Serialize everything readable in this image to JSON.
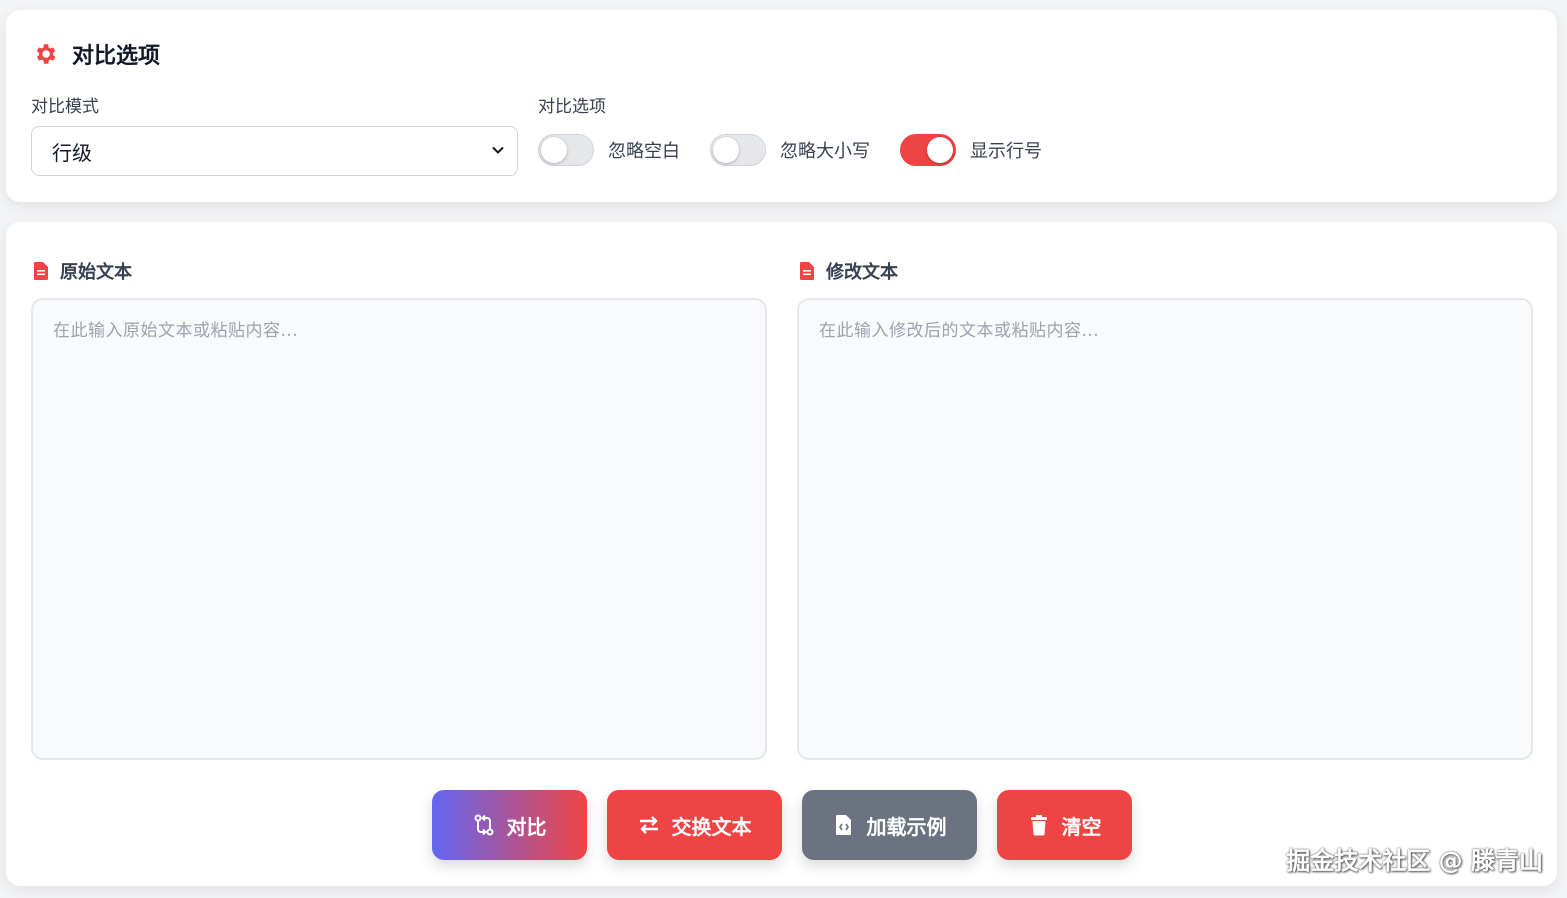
{
  "options": {
    "title": "对比选项",
    "mode_label": "对比模式",
    "mode_value": "行级",
    "options_label": "对比选项",
    "toggles": [
      {
        "label": "忽略空白",
        "on": false
      },
      {
        "label": "忽略大小写",
        "on": false
      },
      {
        "label": "显示行号",
        "on": true
      }
    ]
  },
  "editor": {
    "left_title": "原始文本",
    "left_placeholder": "在此输入原始文本或粘贴内容...",
    "right_title": "修改文本",
    "right_placeholder": "在此输入修改后的文本或粘贴内容..."
  },
  "actions": {
    "compare": "对比",
    "swap": "交换文本",
    "example": "加载示例",
    "clear": "清空"
  },
  "watermark": "掘金技术社区 @ 滕青山",
  "colors": {
    "accent": "#ef4444",
    "gradient_start": "#6366f1",
    "neutral_button": "#6b7280"
  }
}
